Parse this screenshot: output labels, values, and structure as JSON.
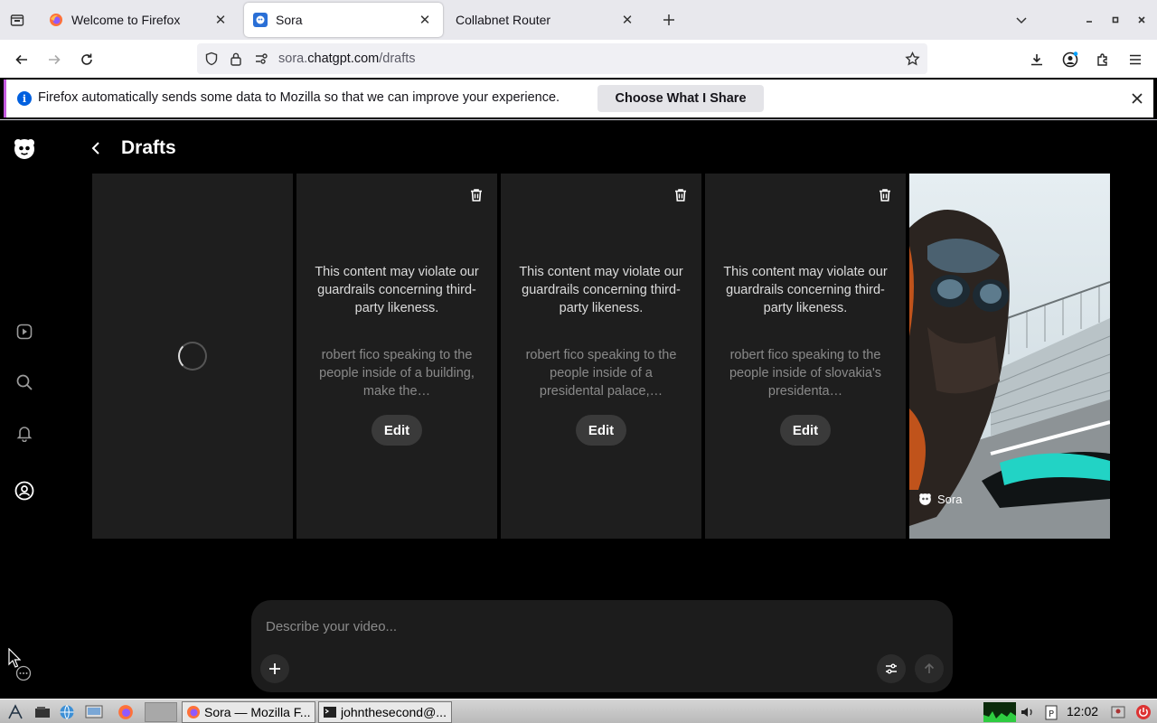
{
  "browser": {
    "tabs": [
      {
        "title": "Welcome to Firefox",
        "active": false
      },
      {
        "title": "Sora",
        "active": true
      },
      {
        "title": "Collabnet Router",
        "active": false
      }
    ],
    "url": {
      "prefix": "sora.",
      "host": "chatgpt.com",
      "path": "/drafts"
    },
    "notification": {
      "message": "Firefox automatically sends some data to Mozilla so that we can improve your experience.",
      "button_label": "Choose What I Share"
    }
  },
  "sora": {
    "page_title": "Drafts",
    "drafts": [
      {
        "state": "loading"
      },
      {
        "warning": "This content may violate our guardrails concerning third-party likeness.",
        "prompt": "robert fico speaking to the people inside of a building, make the…",
        "edit_label": "Edit"
      },
      {
        "warning": "This content may violate our guardrails concerning third-party likeness.",
        "prompt": "robert fico speaking to the people inside of a presidental palace,…",
        "edit_label": "Edit"
      },
      {
        "warning": "This content may violate our guardrails concerning third-party likeness.",
        "prompt": "robert fico speaking to the people inside of slovakia's presidenta…",
        "edit_label": "Edit"
      }
    ],
    "video_watermark": "Sora",
    "composer_placeholder": "Describe your video..."
  },
  "taskbar": {
    "tasks": [
      "Sora — Mozilla F...",
      "johnthesecond@..."
    ],
    "clock": "12:02"
  }
}
